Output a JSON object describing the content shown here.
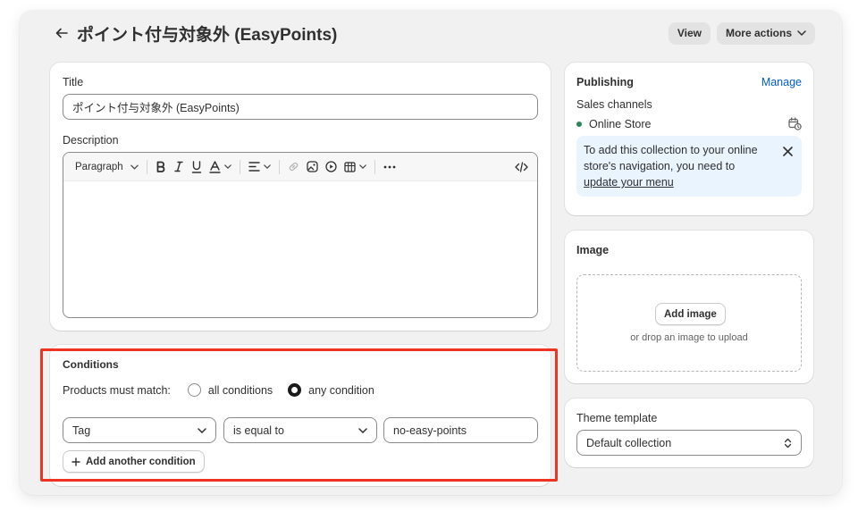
{
  "header": {
    "title": "ポイント付与対象外 (EasyPoints)",
    "view_label": "View",
    "more_actions_label": "More actions"
  },
  "main": {
    "title_label": "Title",
    "title_value": "ポイント付与対象外 (EasyPoints)",
    "description_label": "Description",
    "toolbar": {
      "paragraph_label": "Paragraph",
      "icons": [
        "bold-icon",
        "italic-icon",
        "underline-icon",
        "text-color-icon",
        "align-icon",
        "link-icon",
        "image-icon",
        "video-icon",
        "table-icon",
        "more-icon",
        "code-icon"
      ]
    }
  },
  "conditions": {
    "heading": "Conditions",
    "match_label": "Products must match:",
    "option_all": "all conditions",
    "option_any": "any condition",
    "selected": "any condition",
    "field": "Tag",
    "operator": "is equal to",
    "value": "no-easy-points",
    "add_label": "Add another condition"
  },
  "publishing": {
    "heading": "Publishing",
    "manage_label": "Manage",
    "sales_channels_label": "Sales channels",
    "channel_name": "Online Store",
    "notice_text": "To add this collection to your online store's navigation, you need to",
    "notice_link": "update your menu"
  },
  "image": {
    "heading": "Image",
    "add_label": "Add image",
    "drop_hint": "or drop an image to upload"
  },
  "theme": {
    "label": "Theme template",
    "value": "Default collection"
  },
  "colors": {
    "accent_link": "#005bd3",
    "channel_dot": "#29845a",
    "notice_bg": "#eaf4ff",
    "highlight": "#ee3322"
  }
}
